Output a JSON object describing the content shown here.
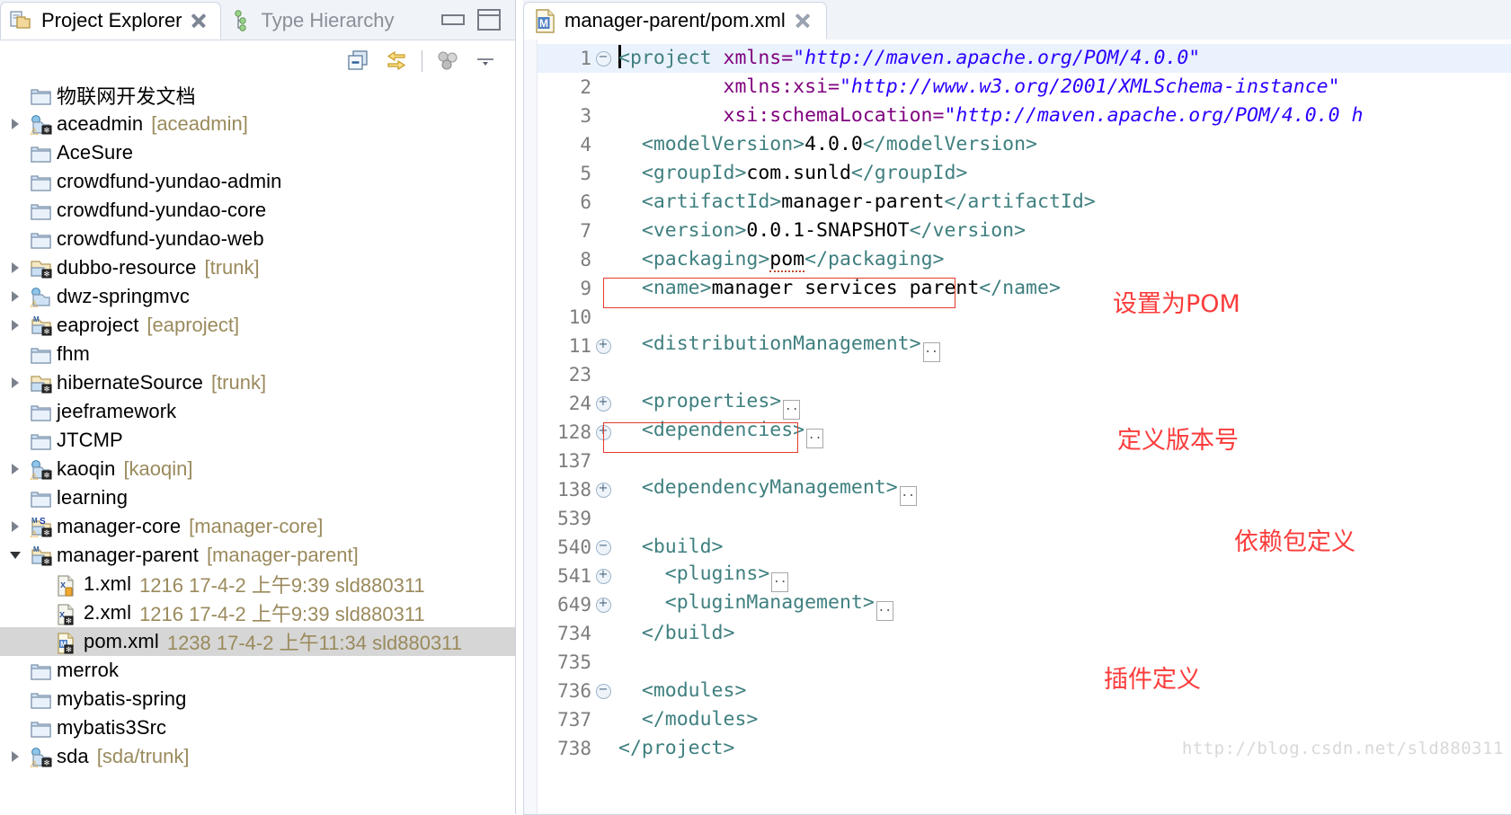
{
  "view_tabs": [
    {
      "label": "Project Explorer",
      "icon": "project-explorer-icon",
      "active": true,
      "closable": true
    },
    {
      "label": "Type Hierarchy",
      "icon": "type-hierarchy-icon",
      "active": false,
      "closable": false
    }
  ],
  "window_controls": {
    "minimize": "minimize",
    "maximize": "maximize"
  },
  "view_toolbar": [
    {
      "name": "collapse-all-icon",
      "title": "Collapse All"
    },
    {
      "name": "link-with-editor-icon",
      "title": "Link with Editor"
    },
    {
      "name": "view-menu-filter-icon",
      "title": "Filters"
    },
    {
      "name": "view-menu-icon",
      "title": "View Menu"
    }
  ],
  "tree": [
    {
      "label": "物联网开发文档",
      "icon": "folder",
      "expander": "none",
      "indent": 0,
      "selected": false,
      "meta": ""
    },
    {
      "label": "aceadmin",
      "icon": "web-project-warn-svn",
      "expander": "right",
      "indent": 0,
      "selected": false,
      "meta": "[aceadmin]"
    },
    {
      "label": "AceSure",
      "icon": "folder",
      "expander": "none",
      "indent": 0,
      "selected": false,
      "meta": ""
    },
    {
      "label": "crowdfund-yundao-admin",
      "icon": "folder",
      "expander": "none",
      "indent": 0,
      "selected": false,
      "meta": ""
    },
    {
      "label": "crowdfund-yundao-core",
      "icon": "folder",
      "expander": "none",
      "indent": 0,
      "selected": false,
      "meta": ""
    },
    {
      "label": "crowdfund-yundao-web",
      "icon": "folder",
      "expander": "none",
      "indent": 0,
      "selected": false,
      "meta": ""
    },
    {
      "label": "dubbo-resource",
      "icon": "project-svn",
      "expander": "right",
      "indent": 0,
      "selected": false,
      "meta": "[trunk]"
    },
    {
      "label": "dwz-springmvc",
      "icon": "web-project-warn",
      "expander": "right",
      "indent": 0,
      "selected": false,
      "meta": ""
    },
    {
      "label": "eaproject",
      "icon": "maven-project-svn",
      "expander": "right",
      "indent": 0,
      "selected": false,
      "meta": "[eaproject]"
    },
    {
      "label": "fhm",
      "icon": "folder",
      "expander": "none",
      "indent": 0,
      "selected": false,
      "meta": ""
    },
    {
      "label": "hibernateSource",
      "icon": "project-svn",
      "expander": "right",
      "indent": 0,
      "selected": false,
      "meta": "[trunk]"
    },
    {
      "label": "jeeframework",
      "icon": "folder",
      "expander": "none",
      "indent": 0,
      "selected": false,
      "meta": ""
    },
    {
      "label": "JTCMP",
      "icon": "folder",
      "expander": "none",
      "indent": 0,
      "selected": false,
      "meta": ""
    },
    {
      "label": "kaoqin",
      "icon": "web-project-warn-svn",
      "expander": "right",
      "indent": 0,
      "selected": false,
      "meta": "[kaoqin]"
    },
    {
      "label": "learning",
      "icon": "folder",
      "expander": "none",
      "indent": 0,
      "selected": false,
      "meta": ""
    },
    {
      "label": "manager-core",
      "icon": "maven-spring-warn-svn",
      "expander": "right",
      "indent": 0,
      "selected": false,
      "meta": "[manager-core]"
    },
    {
      "label": "manager-parent",
      "icon": "maven-project-svn",
      "expander": "down",
      "indent": 0,
      "selected": false,
      "meta": "[manager-parent]"
    },
    {
      "label": "1.xml",
      "icon": "xml-file-lock",
      "expander": "none",
      "indent": 1,
      "selected": false,
      "meta": "1216  17-4-2 上午9:39  sld880311"
    },
    {
      "label": "2.xml",
      "icon": "xml-file-svn",
      "expander": "none",
      "indent": 1,
      "selected": false,
      "meta": "1216  17-4-2 上午9:39  sld880311"
    },
    {
      "label": "pom.xml",
      "icon": "maven-pom-file",
      "expander": "none",
      "indent": 1,
      "selected": true,
      "meta": "1238  17-4-2 上午11:34  sld880311"
    },
    {
      "label": "merrok",
      "icon": "folder",
      "expander": "none",
      "indent": 0,
      "selected": false,
      "meta": ""
    },
    {
      "label": "mybatis-spring",
      "icon": "folder",
      "expander": "none",
      "indent": 0,
      "selected": false,
      "meta": ""
    },
    {
      "label": "mybatis3Src",
      "icon": "folder",
      "expander": "none",
      "indent": 0,
      "selected": false,
      "meta": ""
    },
    {
      "label": "sda",
      "icon": "web-project-warn-svn",
      "expander": "right",
      "indent": 0,
      "selected": false,
      "meta": "[sda/trunk]"
    }
  ],
  "editor": {
    "tab_label": "manager-parent/pom.xml",
    "tab_icon": "maven-pom-icon",
    "tab_close": "close-icon",
    "lines": [
      {
        "num": "1",
        "fold": "minus",
        "highlight": true,
        "caret": true,
        "parts": [
          {
            "t": "tag",
            "s": "<project "
          },
          {
            "t": "attr",
            "s": "xmlns="
          },
          {
            "t": "val",
            "s": "\"http://maven.apache.org/POM/4.0.0\""
          }
        ]
      },
      {
        "num": "2",
        "fold": "",
        "highlight": false,
        "caret": false,
        "parts": [
          {
            "t": "txt",
            "s": "         "
          },
          {
            "t": "attr",
            "s": "xmlns:xsi="
          },
          {
            "t": "val",
            "s": "\"http://www.w3.org/2001/XMLSchema-instance\""
          }
        ]
      },
      {
        "num": "3",
        "fold": "",
        "highlight": false,
        "caret": false,
        "parts": [
          {
            "t": "txt",
            "s": "         "
          },
          {
            "t": "attr",
            "s": "xsi:schemaLocation="
          },
          {
            "t": "val",
            "s": "\"http://maven.apache.org/POM/4.0.0 h"
          }
        ]
      },
      {
        "num": "4",
        "fold": "",
        "highlight": false,
        "caret": false,
        "parts": [
          {
            "t": "txt",
            "s": "  "
          },
          {
            "t": "tag",
            "s": "<modelVersion>"
          },
          {
            "t": "txt",
            "s": "4.0.0"
          },
          {
            "t": "tag",
            "s": "</modelVersion>"
          }
        ]
      },
      {
        "num": "5",
        "fold": "",
        "highlight": false,
        "caret": false,
        "parts": [
          {
            "t": "txt",
            "s": "  "
          },
          {
            "t": "tag",
            "s": "<groupId>"
          },
          {
            "t": "txt",
            "s": "com.sunld"
          },
          {
            "t": "tag",
            "s": "</groupId>"
          }
        ]
      },
      {
        "num": "6",
        "fold": "",
        "highlight": false,
        "caret": false,
        "parts": [
          {
            "t": "txt",
            "s": "  "
          },
          {
            "t": "tag",
            "s": "<artifactId>"
          },
          {
            "t": "txt",
            "s": "manager-parent"
          },
          {
            "t": "tag",
            "s": "</artifactId>"
          }
        ]
      },
      {
        "num": "7",
        "fold": "",
        "highlight": false,
        "caret": false,
        "parts": [
          {
            "t": "txt",
            "s": "  "
          },
          {
            "t": "tag",
            "s": "<version>"
          },
          {
            "t": "txt",
            "s": "0.0.1-SNAPSHOT"
          },
          {
            "t": "tag",
            "s": "</version>"
          }
        ]
      },
      {
        "num": "8",
        "fold": "",
        "highlight": false,
        "caret": false,
        "parts": [
          {
            "t": "txt",
            "s": "  "
          },
          {
            "t": "tag",
            "s": "<packaging>"
          },
          {
            "t": "err",
            "s": "pom"
          },
          {
            "t": "tag",
            "s": "</packaging>"
          }
        ]
      },
      {
        "num": "9",
        "fold": "",
        "highlight": false,
        "caret": false,
        "parts": [
          {
            "t": "txt",
            "s": "  "
          },
          {
            "t": "tag",
            "s": "<name>"
          },
          {
            "t": "txt",
            "s": "manager services parent"
          },
          {
            "t": "tag",
            "s": "</name>"
          }
        ]
      },
      {
        "num": "10",
        "fold": "",
        "highlight": false,
        "caret": false,
        "parts": []
      },
      {
        "num": "11",
        "fold": "plus",
        "highlight": false,
        "caret": false,
        "parts": [
          {
            "t": "txt",
            "s": "  "
          },
          {
            "t": "tag",
            "s": "<distributionManagement>"
          },
          {
            "t": "collapsed",
            "s": ""
          }
        ]
      },
      {
        "num": "23",
        "fold": "",
        "highlight": false,
        "caret": false,
        "parts": []
      },
      {
        "num": "24",
        "fold": "plus",
        "highlight": false,
        "caret": false,
        "parts": [
          {
            "t": "txt",
            "s": "  "
          },
          {
            "t": "tag",
            "s": "<properties>"
          },
          {
            "t": "collapsed",
            "s": ""
          }
        ]
      },
      {
        "num": "128",
        "fold": "plus",
        "highlight": false,
        "caret": false,
        "parts": [
          {
            "t": "txt",
            "s": "  "
          },
          {
            "t": "tag",
            "s": "<dependencies>"
          },
          {
            "t": "collapsed",
            "s": ""
          }
        ]
      },
      {
        "num": "137",
        "fold": "",
        "highlight": false,
        "caret": false,
        "parts": []
      },
      {
        "num": "138",
        "fold": "plus",
        "highlight": false,
        "caret": false,
        "parts": [
          {
            "t": "txt",
            "s": "  "
          },
          {
            "t": "tag",
            "s": "<dependencyManagement>"
          },
          {
            "t": "collapsed",
            "s": ""
          }
        ]
      },
      {
        "num": "539",
        "fold": "",
        "highlight": false,
        "caret": false,
        "parts": []
      },
      {
        "num": "540",
        "fold": "minus",
        "highlight": false,
        "caret": false,
        "parts": [
          {
            "t": "txt",
            "s": "  "
          },
          {
            "t": "tag",
            "s": "<build>"
          }
        ]
      },
      {
        "num": "541",
        "fold": "plus",
        "highlight": false,
        "caret": false,
        "parts": [
          {
            "t": "txt",
            "s": "    "
          },
          {
            "t": "tag",
            "s": "<plugins>"
          },
          {
            "t": "collapsed",
            "s": ""
          }
        ]
      },
      {
        "num": "649",
        "fold": "plus",
        "highlight": false,
        "caret": false,
        "parts": [
          {
            "t": "txt",
            "s": "    "
          },
          {
            "t": "tag",
            "s": "<pluginManagement>"
          },
          {
            "t": "collapsed",
            "s": ""
          }
        ]
      },
      {
        "num": "734",
        "fold": "",
        "highlight": false,
        "caret": false,
        "parts": [
          {
            "t": "txt",
            "s": "  "
          },
          {
            "t": "tag",
            "s": "</build>"
          }
        ]
      },
      {
        "num": "735",
        "fold": "",
        "highlight": false,
        "caret": false,
        "parts": []
      },
      {
        "num": "736",
        "fold": "minus",
        "highlight": false,
        "caret": false,
        "parts": [
          {
            "t": "txt",
            "s": "  "
          },
          {
            "t": "tag",
            "s": "<modules>"
          }
        ]
      },
      {
        "num": "737",
        "fold": "",
        "highlight": false,
        "caret": false,
        "parts": [
          {
            "t": "txt",
            "s": "  "
          },
          {
            "t": "tag",
            "s": "</modules>"
          }
        ]
      },
      {
        "num": "738",
        "fold": "",
        "highlight": false,
        "caret": false,
        "parts": [
          {
            "t": "tag",
            "s": "</project>"
          }
        ]
      }
    ]
  },
  "annotations": [
    {
      "text": "设置为POM",
      "name": "annotation-set-as-pom"
    },
    {
      "text": "定义版本号",
      "name": "annotation-define-version"
    },
    {
      "text": "依赖包定义",
      "name": "annotation-dependency-definition"
    },
    {
      "text": "插件定义",
      "name": "annotation-plugin-definition"
    }
  ],
  "watermark": "http://blog.csdn.net/sld880311",
  "colors": {
    "annotation_red": "#fb3b3b",
    "box_red": "#e23b2e",
    "tag": "#3f7f7f",
    "attr": "#7f007f",
    "value": "#2a00ff",
    "selection": "#d6d6d6",
    "meta_text": "#9a8a5c"
  }
}
